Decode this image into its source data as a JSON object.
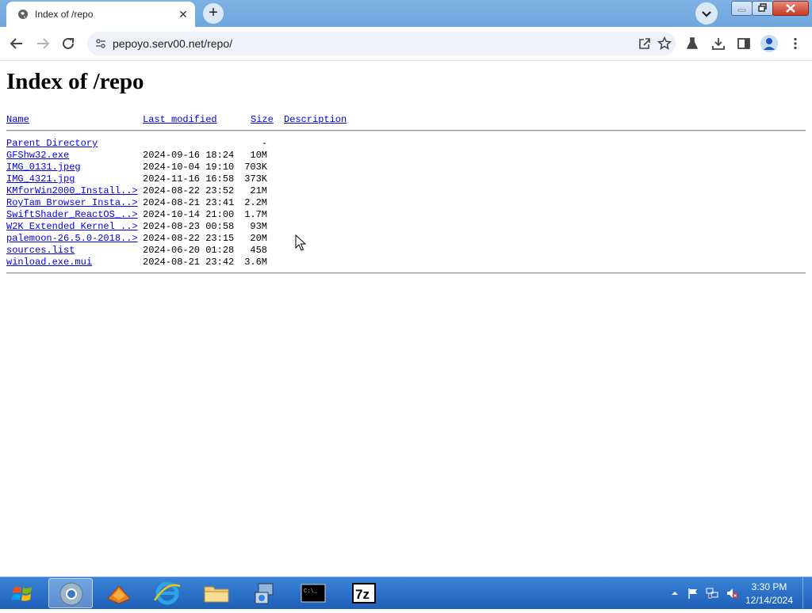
{
  "browser": {
    "tab_title": "Index of /repo",
    "url": "pepoyo.serv00.net/repo/"
  },
  "page": {
    "heading": "Index of /repo",
    "columns": {
      "name": "Name",
      "last_modified": "Last modified",
      "size": "Size",
      "description": "Description"
    },
    "rows": [
      {
        "name": "Parent Directory",
        "date": "",
        "size": "-"
      },
      {
        "name": "GFShw32.exe",
        "date": "2024-09-16 18:24",
        "size": "10M"
      },
      {
        "name": "IMG_0131.jpeg",
        "date": "2024-10-04 19:10",
        "size": "703K"
      },
      {
        "name": "IMG_4321.jpg",
        "date": "2024-11-16 16:58",
        "size": "373K"
      },
      {
        "name": "KMforWin2000_Install..>",
        "date": "2024-08-22 23:52",
        "size": "21M"
      },
      {
        "name": "RoyTam Browser Insta..>",
        "date": "2024-08-21 23:41",
        "size": "2.2M"
      },
      {
        "name": "SwiftShader_ReactOS_..>",
        "date": "2024-10-14 21:00",
        "size": "1.7M"
      },
      {
        "name": "W2K Extended Kernel ..>",
        "date": "2024-08-23 00:58",
        "size": "93M"
      },
      {
        "name": "palemoon-26.5.0-2018..>",
        "date": "2024-08-22 23:15",
        "size": "20M"
      },
      {
        "name": "sources.list",
        "date": "2024-06-20 01:28",
        "size": "458"
      },
      {
        "name": "winload.exe.mui",
        "date": "2024-08-21 23:42",
        "size": "3.6M"
      }
    ]
  },
  "taskbar": {
    "apps": [
      "chrome-icon",
      "firefox-like-icon",
      "internet-explorer-icon",
      "file-explorer-icon",
      "control-panel-icon",
      "command-prompt-icon",
      "7zip-icon"
    ],
    "clock_time": "3:30 PM",
    "clock_date": "12/14/2024"
  },
  "colors": {
    "link": "#0000ee",
    "taskbar": "#1e5fb8",
    "tabstrip": "#6ea6df"
  }
}
